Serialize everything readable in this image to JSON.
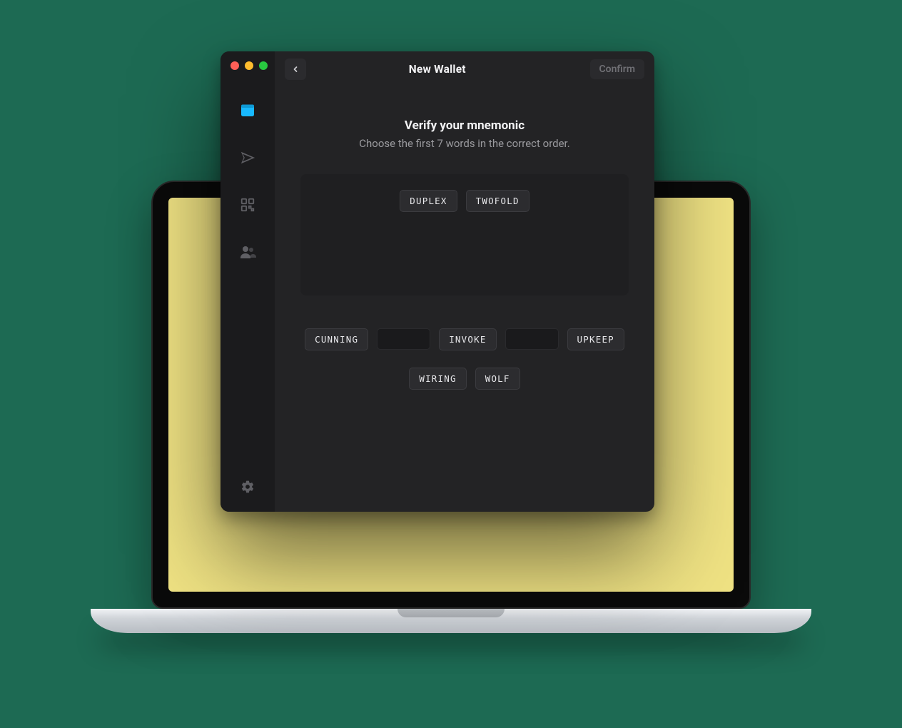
{
  "titlebar": {
    "title": "New Wallet",
    "confirm_label": "Confirm"
  },
  "content": {
    "heading": "Verify your mnemonic",
    "subheading": "Choose the first 7 words in the correct order."
  },
  "selected_words": [
    "DUPLEX",
    "TWOFOLD"
  ],
  "pool_row1": [
    {
      "type": "word",
      "text": "CUNNING"
    },
    {
      "type": "slot"
    },
    {
      "type": "word",
      "text": "INVOKE"
    },
    {
      "type": "slot"
    },
    {
      "type": "word",
      "text": "UPKEEP"
    }
  ],
  "pool_row2": [
    {
      "type": "word",
      "text": "WIRING"
    },
    {
      "type": "word",
      "text": "WOLF"
    }
  ],
  "sidebar": {
    "items": [
      {
        "name": "wallet",
        "active": true
      },
      {
        "name": "send",
        "active": false
      },
      {
        "name": "receive",
        "active": false
      },
      {
        "name": "contacts",
        "active": false
      }
    ]
  }
}
